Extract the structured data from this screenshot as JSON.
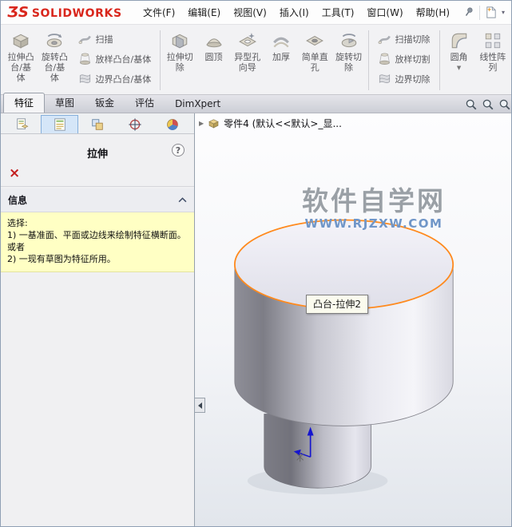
{
  "colors": {
    "logo_red": "#d9261c",
    "selection_orange": "#ff8a1e",
    "message_yellow": "#ffffc4",
    "watermark_blue": "#7096c8"
  },
  "titlebar": {
    "logo_3ds": "ƷS",
    "logo_text": "SOLIDWORKS",
    "menus": {
      "file": "文件(F)",
      "edit": "编辑(E)",
      "view": "视图(V)",
      "insert": "插入(I)",
      "tools": "工具(T)",
      "window": "窗口(W)",
      "help": "帮助(H)"
    }
  },
  "ribbon": {
    "extrude_boss": "拉伸凸台/基体",
    "revolve_boss": "旋转凸台/基体",
    "sweep": "扫描",
    "loft_boss": "放样凸台/基体",
    "boundary_boss": "边界凸台/基体",
    "extrude_cut": "拉伸切除",
    "dome": "圆顶",
    "hole_wizard": "异型孔向导",
    "thicken": "加厚",
    "simple_hole": "简单直孔",
    "revolve_cut": "旋转切除",
    "sweep_cut": "扫描切除",
    "loft_cut": "放样切割",
    "boundary_cut": "边界切除",
    "fillet": "圆角",
    "fillet_caret": "▼",
    "linear_pattern": "线性阵列"
  },
  "tabs": {
    "features": "特征",
    "sketch": "草图",
    "sheet_metal": "钣金",
    "evaluate": "评估",
    "dimxpert": "DimXpert"
  },
  "property_manager": {
    "title": "拉伸",
    "help": "?",
    "cancel": "×",
    "message_header": "信息",
    "message_body": "选择:\n1) 一基准面、平面或边线来绘制特征横断面。\n或者\n2) 一现有草图为特征所用。"
  },
  "viewport": {
    "feature_tree_root": "零件4 (默认<<默认>_显...",
    "expand_arrow": "▶",
    "tooltip": "凸台-拉伸2",
    "watermark_title": "软件自学网",
    "watermark_url": "WWW.RJZXW.COM"
  }
}
